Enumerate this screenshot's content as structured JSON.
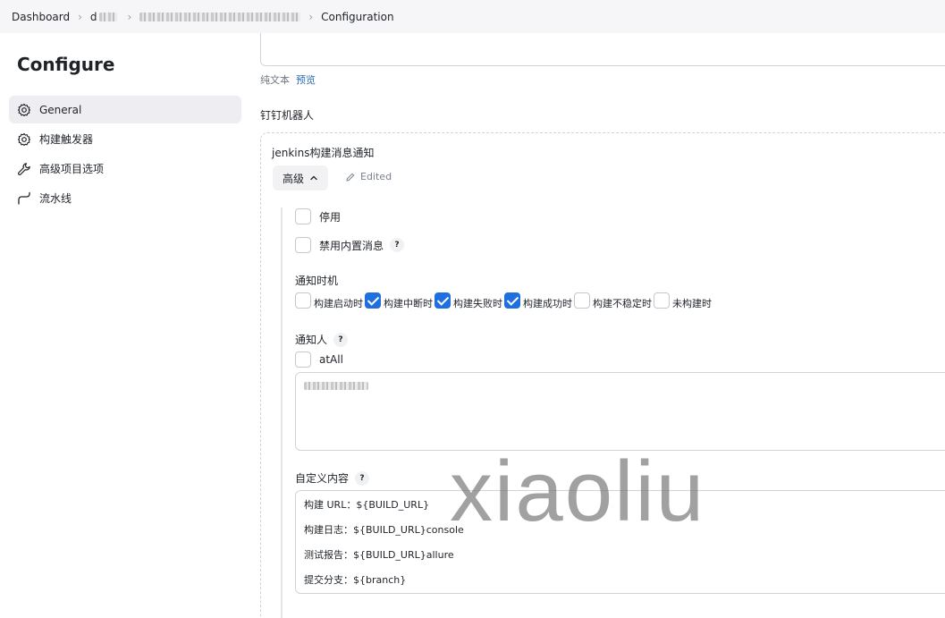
{
  "breadcrumb": {
    "dashboard": "Dashboard",
    "item1": "d",
    "current": "Configuration"
  },
  "sidebar": {
    "title": "Configure",
    "items": [
      {
        "label": "General",
        "icon": "gear-icon",
        "active": true
      },
      {
        "label": "构建触发器",
        "icon": "gear-icon",
        "active": false
      },
      {
        "label": "高级项目选项",
        "icon": "wrench-icon",
        "active": false
      },
      {
        "label": "流水线",
        "icon": "pipeline-icon",
        "active": false
      }
    ]
  },
  "editor_links": {
    "plain": "纯文本",
    "preview": "预览"
  },
  "dingtalk": {
    "section_label": "钉钉机器人",
    "robot_name": "jenkins构建消息通知",
    "advanced_label": "高级",
    "edited_label": "Edited",
    "disable_label": "停用",
    "disable_builtin_label": "禁用内置消息",
    "timing_label": "通知时机",
    "timing_options": [
      {
        "label": "构建启动时",
        "checked": false
      },
      {
        "label": "构建中断时",
        "checked": true
      },
      {
        "label": "构建失败时",
        "checked": true
      },
      {
        "label": "构建成功时",
        "checked": true
      },
      {
        "label": "构建不稳定时",
        "checked": false
      },
      {
        "label": "未构建时",
        "checked": false
      }
    ],
    "notifier_label": "通知人",
    "at_all_label": "atAll",
    "custom_content_label": "自定义内容",
    "custom_content_lines": [
      "构建 URL：${BUILD_URL}",
      "构建日志：${BUILD_URL}console",
      "测试报告：${BUILD_URL}allure",
      "提交分支：${branch}"
    ]
  },
  "help_icon_text": "?",
  "watermark": "xiaoliu",
  "colors": {
    "accent": "#1f6fe0",
    "link": "#2a6bb3",
    "sidebar_active_bg": "#eeeef2",
    "topbar_bg": "#f6f6f8"
  }
}
